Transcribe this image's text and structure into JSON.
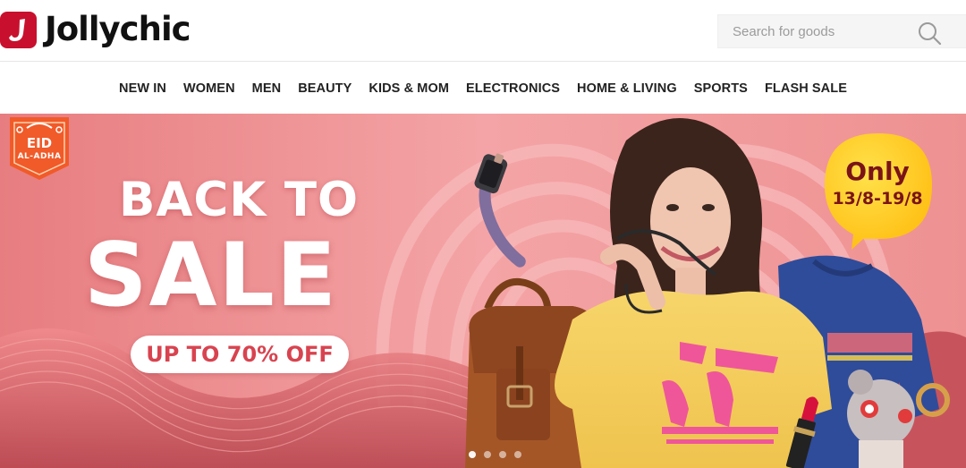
{
  "header": {
    "brand_name": "Jollychic",
    "brand_color": "#c8102e",
    "search": {
      "placeholder": "Search for goods",
      "value": "",
      "button_icon": "search-icon"
    }
  },
  "nav": {
    "items": [
      {
        "label": "NEW IN"
      },
      {
        "label": "WOMEN"
      },
      {
        "label": "MEN"
      },
      {
        "label": "BEAUTY"
      },
      {
        "label": "KIDS & MOM"
      },
      {
        "label": "ELECTRONICS"
      },
      {
        "label": "HOME & LIVING"
      },
      {
        "label": "SPORTS"
      },
      {
        "label": "FLASH SALE"
      }
    ]
  },
  "banner": {
    "badge": {
      "line1": "EID",
      "line2": "AL-ADHA",
      "color": "#f15a29"
    },
    "headline_top": "BACK TO",
    "headline_main": "SALE",
    "discount": "UP TO 70% OFF",
    "promo_bubble": {
      "line1": "Only",
      "line2": "13/8-19/8",
      "color": "#ffcc1f"
    },
    "background_color": "#ec8b8e",
    "accent_text_color": "#d8434f",
    "slide_count": 4,
    "active_slide": 1
  }
}
